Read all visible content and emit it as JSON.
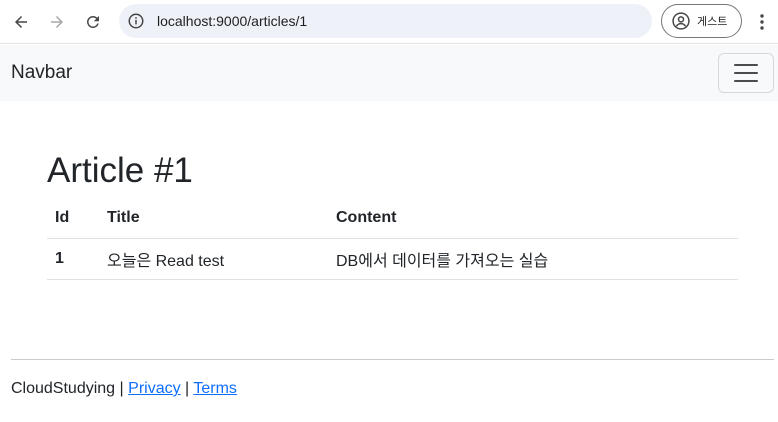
{
  "browser": {
    "url": "localhost:9000/articles/1",
    "profile_label": "게스트"
  },
  "navbar": {
    "brand": "Navbar"
  },
  "main": {
    "heading": "Article #1",
    "table": {
      "headers": [
        "Id",
        "Title",
        "Content"
      ],
      "rows": [
        [
          "1",
          "오늘은 Read test",
          "DB에서 데이터를 가져오는 실습"
        ]
      ]
    }
  },
  "footer": {
    "brand": "CloudStudying",
    "separator": "|",
    "links": [
      "Privacy",
      "Terms"
    ]
  },
  "colors": {
    "link": "#0d6efd",
    "navbar_bg": "#f8f9fa",
    "omnibox_bg": "#eef1f8"
  }
}
